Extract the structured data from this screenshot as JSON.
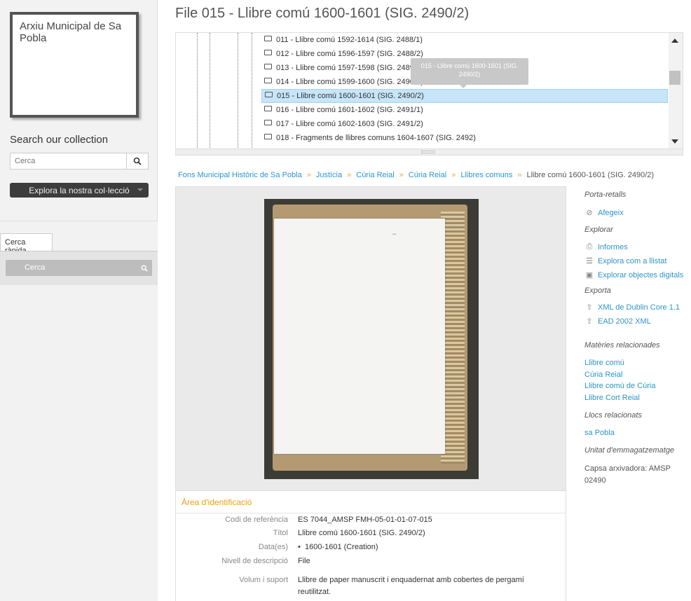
{
  "sidebar": {
    "logo_text": "Arxiu Municipal de Sa Pobla",
    "search_title": "Search our collection",
    "search_placeholder": "Cerca",
    "browse_button": "Explora la nostra col·lecció",
    "quick_tab": "Cerca ràpida",
    "quick_search": "Cerca"
  },
  "main": {
    "title": "File 015 - Llibre comú 1600-1601 (SIG. 2490/2)",
    "tree": {
      "items": [
        "011 - Llibre comú 1592-1614 (SIG. 2488/1)",
        "012 - Llibre comú 1596-1597 (SIG. 2488/2)",
        "013 - Llibre comú 1597-1598 (SIG. 2489)",
        "014 - Llibre comú 1599-1600 (SIG. 2490/1)",
        "015 - Llibre comú 1600-1601 (SIG. 2490/2)",
        "016 - Llibre comú 1601-1602 (SIG. 2491/1)",
        "017 - Llibre comú 1602-1603 (SIG. 2491/2)",
        "018 - Fragments de llibres comuns 1604-1607 (SIG. 2492)"
      ],
      "tooltip": "015 - Llibre comú 1600-1601 (SIG. 2490/2)"
    },
    "breadcrumb": {
      "links": [
        "Fons Municipal Històric de Sa Pobla",
        "Justícia",
        "Cúria Reial",
        "Cúria Reial",
        "Llibres comuns"
      ],
      "current": "Llibre comú 1600-1601 (SIG. 2490/2)"
    },
    "identification": {
      "title": "Àrea d'identificació",
      "ref_label": "Codi de referència",
      "ref_value": "ES 7044_AMSP FMH-05-01-01-07-015",
      "title_label": "Títol",
      "title_value": "Llibre comú 1600-1601 (SIG. 2490/2)",
      "dates_label": "Data(es)",
      "dates_value": "1600-1601 (Creation)",
      "level_label": "Nivell de descripció",
      "level_value": "File",
      "extent_label": "Volum i suport",
      "extent_value": "Llibre de paper manuscrit i enquadernat amb cobertes de pergamí reutilitzat."
    }
  },
  "right": {
    "clipboard_head": "Porta-retalls",
    "add_link": "Afegeix",
    "explore_head": "Explorar",
    "reports_link": "Informes",
    "list_link": "Explora com a llistat",
    "digital_link": "Explorar objectes digitals",
    "export_head": "Exporta",
    "dc_link": "XML de Dublin Core 1.1",
    "ead_link": "EAD 2002 XML",
    "subjects_head": "Matèries relacionades",
    "subjects": [
      "Llibre comú",
      "Cúria Reial",
      "Llibre comú de Cúria",
      "Llibre Cort Reial"
    ],
    "places_head": "Llocs relacionats",
    "places": [
      "sa Pobla"
    ],
    "storage_head": "Unitat d'emmagatzematge",
    "storage_value": "Capsa arxivadora: AMSP 02490"
  },
  "colors": {
    "link": "#2c95c9",
    "accent": "#e8a018",
    "active_row": "#c7e5f8"
  },
  "icons": [
    "search-icon",
    "folder-icon",
    "paperclip-icon",
    "print-icon",
    "list-icon",
    "image-icon",
    "upload-icon"
  ]
}
